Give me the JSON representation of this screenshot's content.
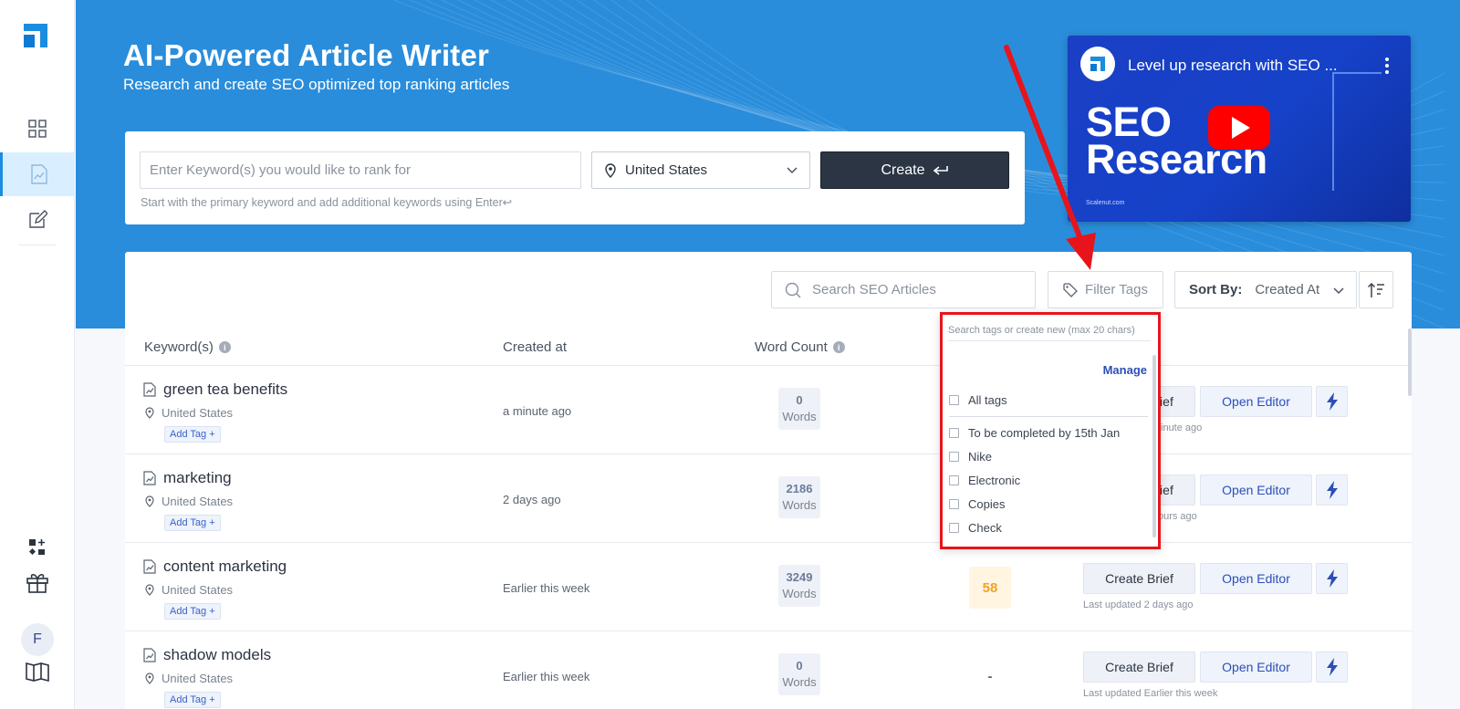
{
  "hero": {
    "title": "AI-Powered Article Writer",
    "subtitle": "Research and create SEO optimized top ranking articles"
  },
  "create": {
    "keyword_placeholder": "Enter Keyword(s) you would like to rank for",
    "location": "United States",
    "button_label": "Create",
    "hint": "Start with the primary keyword and add additional keywords using Enter↩"
  },
  "video": {
    "title": "Level up research with SEO ...",
    "big_text_line1": "SEO",
    "big_text_line2": "Research",
    "small_text": "Scalenut.com"
  },
  "toolbar": {
    "search_placeholder": "Search SEO Articles",
    "filter_label": "Filter Tags",
    "sort_label": "Sort By:",
    "sort_value": "Created At"
  },
  "table": {
    "headers": [
      "Keyword(s)",
      "Created at",
      "Word Count"
    ],
    "rows": [
      {
        "keyword": "green tea benefits",
        "location": "United States",
        "add_tag": "Add Tag +",
        "created": "a minute ago",
        "words": "0",
        "words_label": "Words",
        "grade": "",
        "brief": "Create Brief",
        "editor": "Open Editor",
        "updated": "Last updated a minute ago"
      },
      {
        "keyword": "marketing",
        "location": "United States",
        "add_tag": "Add Tag +",
        "created": "2 days ago",
        "words": "2186",
        "words_label": "Words",
        "grade": "",
        "brief": "Create Brief",
        "editor": "Open Editor",
        "updated": "Last updated 4 hours ago"
      },
      {
        "keyword": "content marketing",
        "location": "United States",
        "add_tag": "Add Tag +",
        "created": "Earlier this week",
        "words": "3249",
        "words_label": "Words",
        "grade": "58",
        "brief": "Create Brief",
        "editor": "Open Editor",
        "updated": "Last updated 2 days ago"
      },
      {
        "keyword": "shadow models",
        "location": "United States",
        "add_tag": "Add Tag +",
        "created": "Earlier this week",
        "words": "0",
        "words_label": "Words",
        "grade": "-",
        "brief": "Create Brief",
        "editor": "Open Editor",
        "updated": "Last updated Earlier this week"
      }
    ]
  },
  "tag_dropdown": {
    "search_placeholder": "Search tags or create new (max 20 chars)",
    "manage": "Manage",
    "all_tags": "All tags",
    "tags": [
      "To be completed by 15th Jan",
      "Nike",
      "Electronic",
      "Copies",
      "Check"
    ]
  },
  "sidebar": {
    "avatar_initial": "F"
  },
  "colors": {
    "hero_bg": "#2a8ddb",
    "accent": "#1a8de0",
    "highlight": "#e8141b"
  }
}
